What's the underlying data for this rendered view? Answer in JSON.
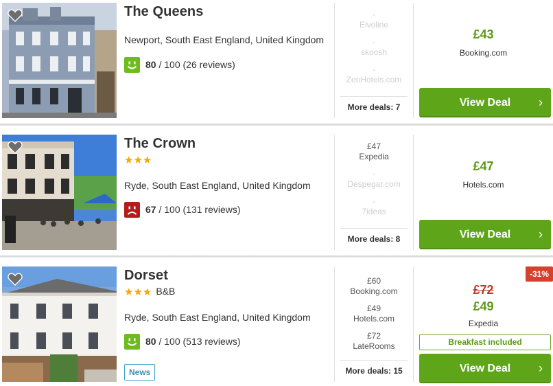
{
  "hotels": [
    {
      "name": "The Queens",
      "stars": "",
      "type": "",
      "location": "Newport, South East England, United Kingdom",
      "rating": {
        "score": "80",
        "of": "/ 100",
        "reviews": "(26 reviews)",
        "mood": "happy",
        "color": "#6dbb1f"
      },
      "badge": "",
      "deals": [
        {
          "price": "-",
          "provider": "Elvoline",
          "faded": true
        },
        {
          "price": "-",
          "provider": "skoosh",
          "faded": true
        },
        {
          "price": "-",
          "provider": "ZenHotels.com",
          "faded": true
        }
      ],
      "more_deals": "More deals: 7",
      "old_price": "",
      "best_price": "£43",
      "best_provider": "Booking.com",
      "perk": "",
      "discount": "",
      "cta": "View Deal"
    },
    {
      "name": "The Crown",
      "stars": "★★★",
      "type": "",
      "location": "Ryde, South East England, United Kingdom",
      "rating": {
        "score": "67",
        "of": "/ 100",
        "reviews": "(131 reviews)",
        "mood": "sad",
        "color": "#b51c1c"
      },
      "badge": "",
      "deals": [
        {
          "price": "£47",
          "provider": "Expedia",
          "faded": false
        },
        {
          "price": "-",
          "provider": "Despegar.com",
          "faded": true
        },
        {
          "price": "-",
          "provider": "7ideas",
          "faded": true
        }
      ],
      "more_deals": "More deals: 8",
      "old_price": "",
      "best_price": "£47",
      "best_provider": "Hotels.com",
      "perk": "",
      "discount": "",
      "cta": "View Deal"
    },
    {
      "name": "Dorset",
      "stars": "★★★",
      "type": "B&B",
      "location": "Ryde, South East England, United Kingdom",
      "rating": {
        "score": "80",
        "of": "/ 100",
        "reviews": "(513 reviews)",
        "mood": "happy",
        "color": "#6dbb1f"
      },
      "badge": "News",
      "deals": [
        {
          "price": "£60",
          "provider": "Booking.com",
          "faded": false
        },
        {
          "price": "£49",
          "provider": "Hotels.com",
          "faded": false
        },
        {
          "price": "£72",
          "provider": "LateRooms",
          "faded": false
        }
      ],
      "more_deals": "More deals: 15",
      "old_price": "£72",
      "best_price": "£49",
      "best_provider": "Expedia",
      "perk": "Breakfast included",
      "discount": "-31%",
      "cta": "View Deal"
    }
  ],
  "icons": {
    "favorite": "heart-icon",
    "chevron": "chevron-right-icon",
    "smiley_happy": "smiley-happy-icon",
    "smiley_sad": "smiley-sad-icon"
  },
  "colors": {
    "accent_green": "#5ea51a",
    "price_green": "#5a9a14",
    "star_gold": "#f2a900",
    "discount_red": "#d7402b",
    "news_blue": "#3a8fb7"
  }
}
